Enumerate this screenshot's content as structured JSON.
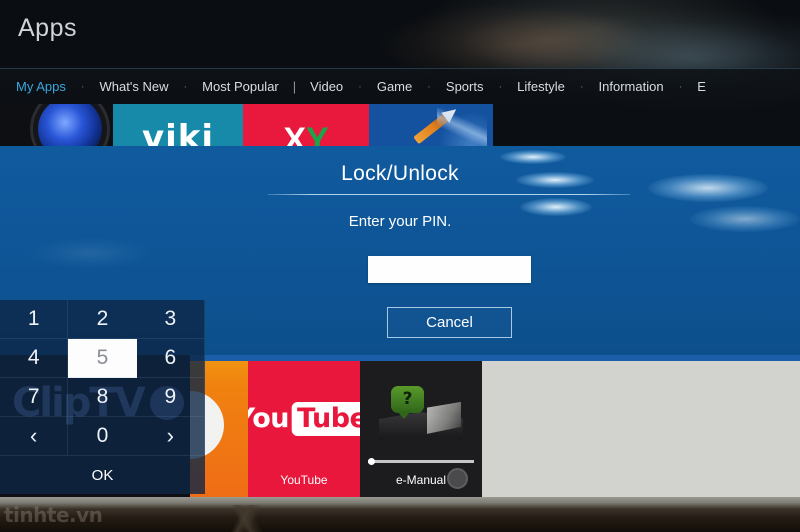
{
  "header": {
    "title": "Apps"
  },
  "nav": {
    "items": [
      {
        "label": "My Apps",
        "active": true
      },
      {
        "label": "What's New",
        "active": false
      },
      {
        "label": "Most Popular",
        "active": false
      },
      {
        "label": "Video",
        "active": false
      },
      {
        "label": "Game",
        "active": false
      },
      {
        "label": "Sports",
        "active": false
      },
      {
        "label": "Lifestyle",
        "active": false
      },
      {
        "label": "Information",
        "active": false
      },
      {
        "label": "E",
        "active": false
      }
    ],
    "separator_dot": "·",
    "separator_bar": "|"
  },
  "tiles_top": [
    {
      "name": "camera-lens-app",
      "label": ""
    },
    {
      "name": "viki-app",
      "label": "viki"
    },
    {
      "name": "xy-app",
      "label": "XY"
    },
    {
      "name": "paint-app",
      "label": ""
    }
  ],
  "tiles_bottom": [
    {
      "name": "orange-app",
      "label": ""
    },
    {
      "name": "youtube-app",
      "label": "YouTube"
    },
    {
      "name": "emanual-app",
      "label": "e-Manual",
      "badge": "?"
    }
  ],
  "dialog": {
    "title": "Lock/Unlock",
    "prompt": "Enter your PIN.",
    "pin_value": "",
    "pin_placeholder": "",
    "cancel_label": "Cancel"
  },
  "keypad": {
    "keys": [
      {
        "label": "1",
        "selected": false,
        "kind": "digit"
      },
      {
        "label": "2",
        "selected": false,
        "kind": "digit"
      },
      {
        "label": "3",
        "selected": false,
        "kind": "digit"
      },
      {
        "label": "4",
        "selected": false,
        "kind": "digit"
      },
      {
        "label": "5",
        "selected": true,
        "kind": "digit"
      },
      {
        "label": "6",
        "selected": false,
        "kind": "digit"
      },
      {
        "label": "7",
        "selected": false,
        "kind": "digit"
      },
      {
        "label": "8",
        "selected": false,
        "kind": "digit"
      },
      {
        "label": "9",
        "selected": false,
        "kind": "digit"
      },
      {
        "label": "‹",
        "selected": false,
        "kind": "arrow-left"
      },
      {
        "label": "0",
        "selected": false,
        "kind": "digit"
      },
      {
        "label": "›",
        "selected": false,
        "kind": "arrow-right"
      }
    ],
    "ok_label": "OK"
  },
  "watermarks": {
    "keypad_logo": "ClipTV",
    "photo": "tinhte.vn"
  },
  "colors": {
    "accent_blue": "#3ba7dd",
    "dialog_blue": "#0e5596",
    "keypad_navy": "#0e2646",
    "youtube_red": "#e9173b",
    "viki_teal": "#168aa8",
    "selected_key_bg": "#fdfdfd"
  }
}
